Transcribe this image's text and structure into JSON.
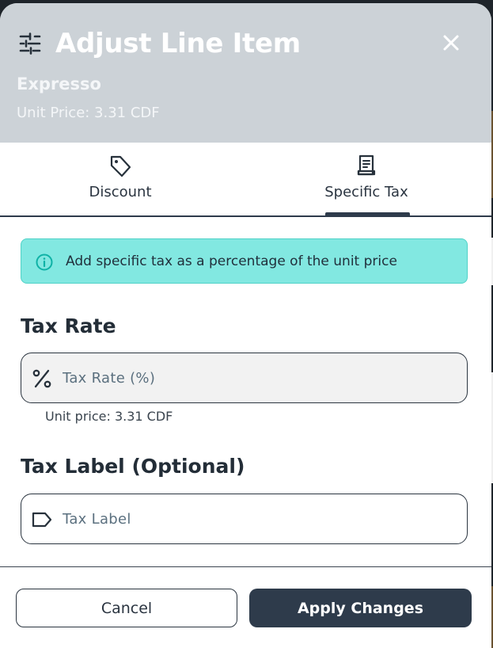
{
  "modal": {
    "title": "Adjust Line Item",
    "item_name": "Expresso",
    "unit_price": "Unit Price: 3.31 CDF"
  },
  "tabs": [
    {
      "label": "Discount",
      "icon": "tag-icon",
      "active": false
    },
    {
      "label": "Specific Tax",
      "icon": "receipt-icon",
      "active": true
    }
  ],
  "info": {
    "text": "Add specific tax as a percentage of the unit price",
    "icon": "info-icon"
  },
  "tax_rate": {
    "label": "Tax Rate",
    "placeholder": "Tax Rate (%)",
    "value": "",
    "hint": "Unit price: 3.31 CDF",
    "icon": "percent-icon"
  },
  "tax_label": {
    "label": "Tax Label (Optional)",
    "placeholder": "Tax Label",
    "value": "",
    "icon": "label-icon"
  },
  "footer": {
    "cancel_label": "Cancel",
    "apply_label": "Apply Changes"
  },
  "colors": {
    "header_bg": "#ccd2d7",
    "primary": "#2e3b4b",
    "info_bg": "#82e8e1"
  }
}
